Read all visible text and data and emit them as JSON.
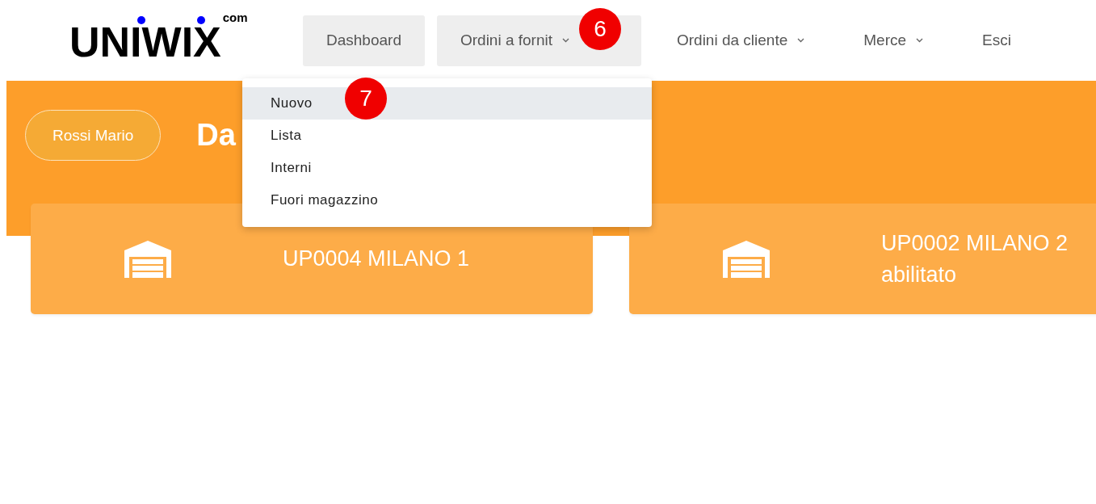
{
  "logo": {
    "name": "UNIWIX",
    "suffix": "com"
  },
  "nav": [
    {
      "label": "Dashboard",
      "has_menu": false,
      "selected": false
    },
    {
      "label": "Ordini a fornit",
      "has_menu": true,
      "selected": true
    },
    {
      "label": "Ordini da cliente",
      "has_menu": true,
      "selected": false
    },
    {
      "label": "Merce",
      "has_menu": true,
      "selected": false
    },
    {
      "label": "Esci",
      "has_menu": false,
      "selected": false
    }
  ],
  "dropdown": {
    "items": [
      {
        "label": "Nuovo",
        "selected": true
      },
      {
        "label": "Lista",
        "selected": false
      },
      {
        "label": "Interni",
        "selected": false
      },
      {
        "label": "Fuori magazzino",
        "selected": false
      }
    ]
  },
  "user_button": "Rossi Mario",
  "heading": "Da",
  "cards": [
    {
      "lines": [
        "UP0004 MILANO 1"
      ]
    },
    {
      "lines": [
        "UP0002 MILANO 2",
        "abilitato"
      ]
    }
  ],
  "callouts": [
    "6",
    "7"
  ]
}
